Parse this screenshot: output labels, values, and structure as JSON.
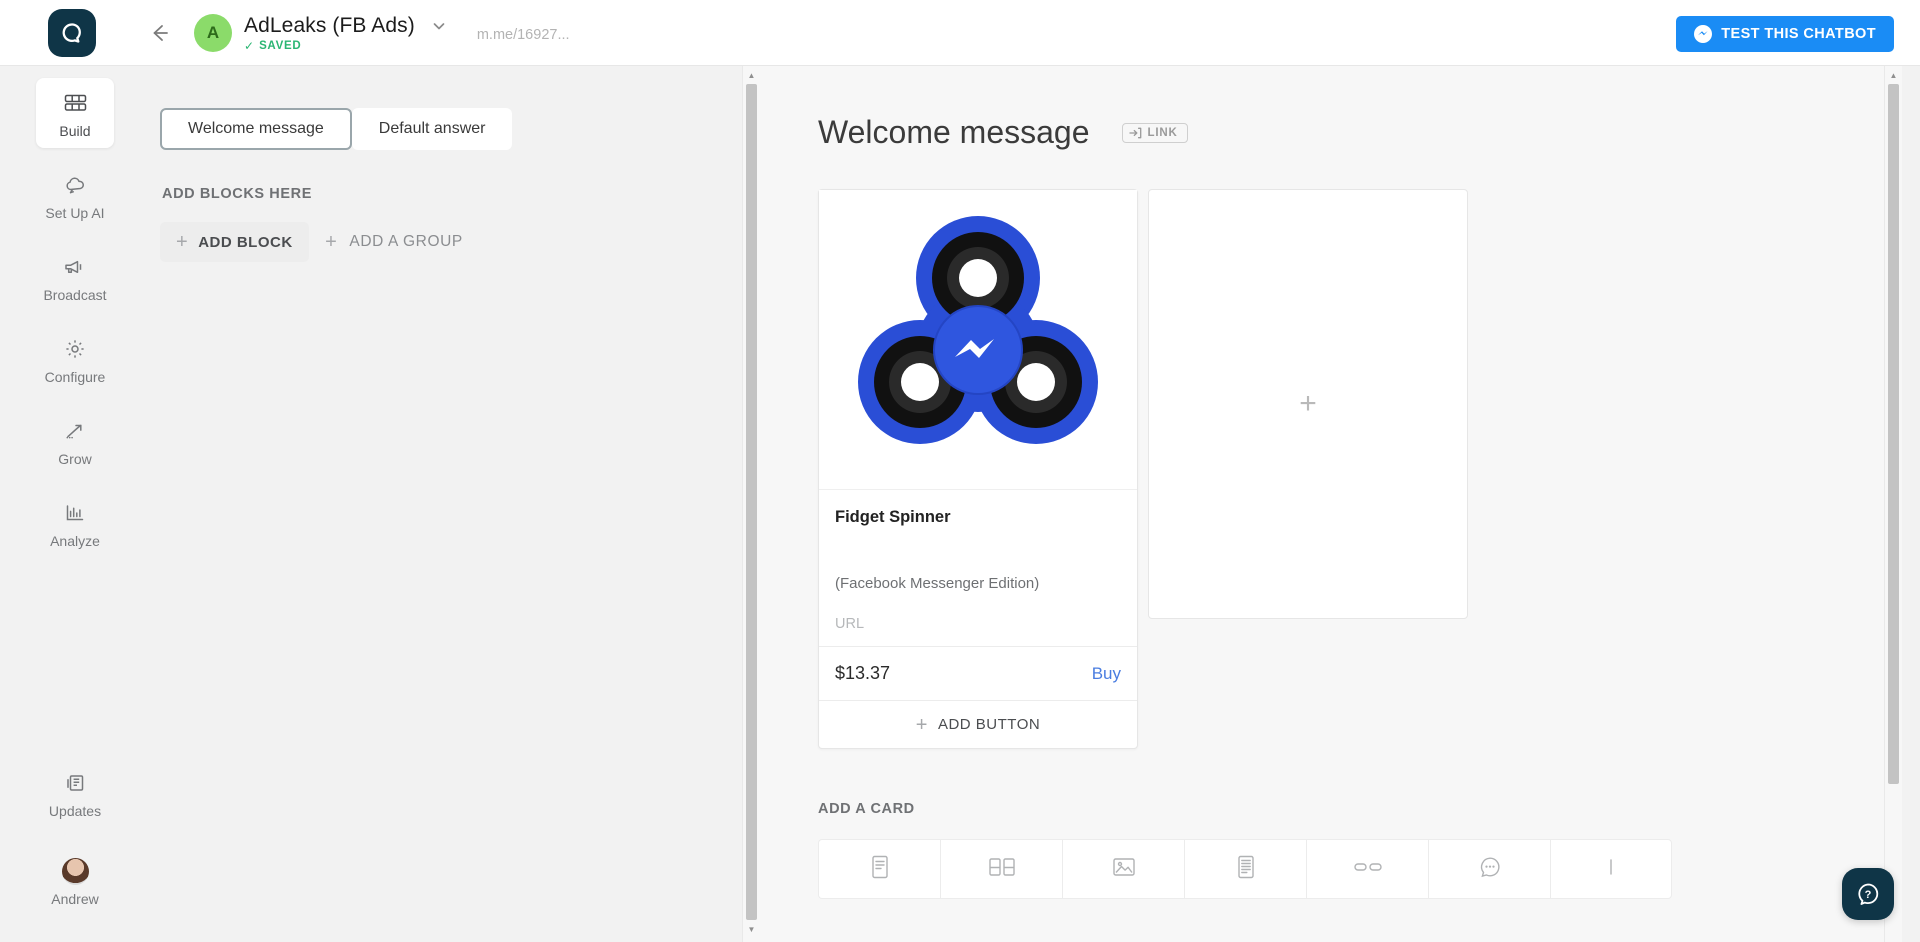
{
  "app": {
    "logo_icon": "manychat-logo-icon",
    "help_icon": "question-bubble-icon"
  },
  "topbar": {
    "back_icon": "back-arrow-icon",
    "avatar_initial": "A",
    "page_title": "AdLeaks (FB Ads)",
    "chevron_icon": "chevron-down-icon",
    "saved_tick": "✓",
    "saved_label": "SAVED",
    "page_url": "m.me/16927...",
    "test_button_label": "TEST THIS CHATBOT",
    "test_button_icon": "messenger-icon",
    "test_button_color": "#1a8cf5"
  },
  "sidebar": {
    "items": [
      {
        "label": "Build",
        "icon": "grid-blocks-icon",
        "active": true
      },
      {
        "label": "Set Up AI",
        "icon": "ai-cloud-icon",
        "active": false
      },
      {
        "label": "Broadcast",
        "icon": "megaphone-icon",
        "active": false
      },
      {
        "label": "Configure",
        "icon": "gear-icon",
        "active": false
      },
      {
        "label": "Grow",
        "icon": "trend-arrow-icon",
        "active": false
      },
      {
        "label": "Analyze",
        "icon": "bar-chart-icon",
        "active": false
      }
    ],
    "bottom": [
      {
        "label": "Updates",
        "icon": "updates-icon"
      },
      {
        "label": "Andrew",
        "icon": "user-avatar-icon"
      }
    ]
  },
  "left_panel": {
    "tabs": [
      {
        "label": "Welcome message",
        "active": true
      },
      {
        "label": "Default answer",
        "active": false
      }
    ],
    "blocks_section_label": "ADD BLOCKS HERE",
    "add_block_label": "ADD BLOCK",
    "add_group_label": "ADD A GROUP",
    "plus_icon": "plus-icon"
  },
  "main": {
    "title": "Welcome message",
    "link_badge_label": "LINK",
    "link_badge_icon": "link-in-icon",
    "product_card": {
      "image_icon": "fidget-spinner-image",
      "title": "Fidget Spinner",
      "subtitle": "(Facebook Messenger Edition)",
      "url_placeholder": "URL",
      "price": "$13.37",
      "buy_label": "Buy",
      "add_button_label": "ADD BUTTON"
    },
    "empty_card": {
      "plus_icon": "plus-icon"
    },
    "add_card_label": "ADD A CARD",
    "card_types": [
      {
        "name": "text-card",
        "icon": "text-card-icon"
      },
      {
        "name": "gallery-card",
        "icon": "gallery-card-icon"
      },
      {
        "name": "image-card",
        "icon": "image-card-icon"
      },
      {
        "name": "list-card",
        "icon": "list-card-icon"
      },
      {
        "name": "buttons-card",
        "icon": "buttons-card-icon"
      },
      {
        "name": "delay-card",
        "icon": "typing-delay-icon"
      },
      {
        "name": "more-card",
        "icon": "more-card-icon"
      }
    ]
  },
  "scrollbars": {
    "up_arrow": "▲",
    "down_arrow": "▼"
  }
}
